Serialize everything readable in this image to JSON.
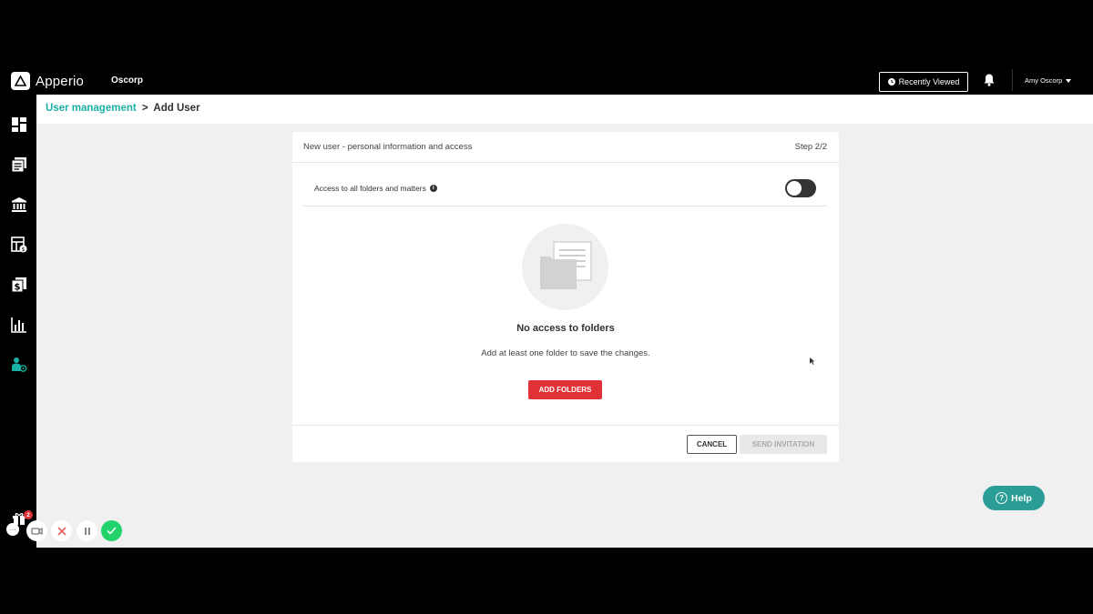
{
  "app": {
    "brand": "Apperio",
    "org": "Oscorp",
    "recently_viewed": "Recently Viewed",
    "user_name": "Amy Oscorp"
  },
  "sidebar": {
    "items": [
      {
        "icon": "dashboard-icon"
      },
      {
        "icon": "documents-icon"
      },
      {
        "icon": "bank-icon"
      },
      {
        "icon": "budget-icon"
      },
      {
        "icon": "invoices-icon"
      },
      {
        "icon": "analytics-icon"
      },
      {
        "icon": "user-management-icon",
        "active": true
      }
    ]
  },
  "breadcrumb": {
    "link": "User management",
    "separator": ">",
    "current": "Add User"
  },
  "card": {
    "title": "New user - personal information and access",
    "step": "Step 2/2",
    "access_label": "Access to all folders and matters",
    "access_toggle_on": false,
    "empty_title": "No access to folders",
    "empty_sub": "Add at least one folder to save the changes.",
    "add_folders": "ADD FOLDERS",
    "cancel": "CANCEL",
    "send_invitation": "SEND INVITATION"
  },
  "help": {
    "label": "Help"
  },
  "recorder": {
    "badge_count": "2"
  },
  "colors": {
    "accent": "#1ab0a4",
    "danger": "#e03137",
    "help": "#2a9d97",
    "success": "#22d26b"
  }
}
